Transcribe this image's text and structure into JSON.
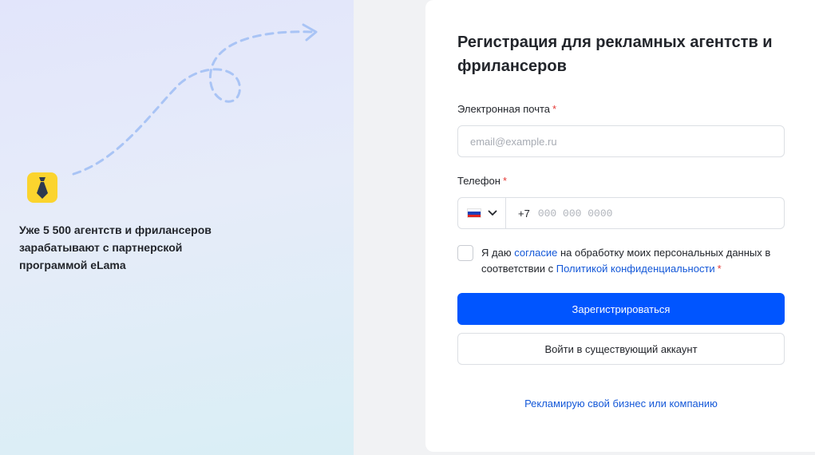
{
  "promo": {
    "text": "Уже 5 500 агентств и фрилансеров зарабатывают с партнерской программой eLama"
  },
  "form": {
    "title": "Регистрация для рекламных агентств и фрилансеров",
    "email": {
      "label": "Электронная почта",
      "required_mark": "*",
      "placeholder": "email@example.ru",
      "value": ""
    },
    "phone": {
      "label": "Телефон",
      "required_mark": "*",
      "country_flag": "ru-flag-icon",
      "code": "+7",
      "placeholder": "000 000 0000",
      "value": ""
    },
    "consent": {
      "checked": false,
      "text_1": "Я даю",
      "link_1": "согласие",
      "text_2": "на обработку моих персональных данных в соответствии с",
      "link_2": "Политикой конфиденциальности",
      "required_mark": "*"
    },
    "register_button": "Зарегистрироваться",
    "login_button": "Войти в существующий аккаунт",
    "business_link": "Рекламирую свой бизнес или компанию"
  },
  "colors": {
    "primary": "#0055ff",
    "link": "#1458d8",
    "required": "#e53935",
    "logo": "#fbd42e"
  }
}
